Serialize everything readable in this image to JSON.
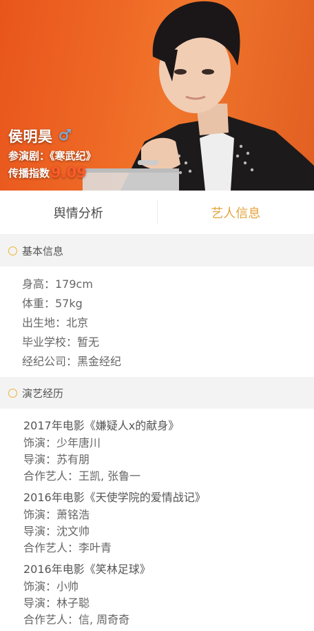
{
  "artist": {
    "name": "侯明昊",
    "gender_icon": "male-icon",
    "drama_line": "参演剧：《寒武纪》",
    "index_label": "传播指数",
    "index_value": "9.09"
  },
  "tabs": [
    {
      "label": "舆情分析",
      "active": false
    },
    {
      "label": "艺人信息",
      "active": true
    }
  ],
  "sections": {
    "basic": {
      "title": "基本信息",
      "items": [
        "身高：179cm",
        "体重：57kg",
        "出生地：北京",
        "毕业学校：暂无",
        "经纪公司：黑金经纪"
      ]
    },
    "career": {
      "title": "演艺经历",
      "entries": [
        {
          "title": "2017年电影《嫌疑人x的献身》",
          "role": "饰演：少年唐川",
          "director": "导演：苏有朋",
          "costars": "合作艺人：王凯, 张鲁一"
        },
        {
          "title": "2016年电影《天使学院的爱情战记》",
          "role": "饰演：萧铭浩",
          "director": "导演：沈文帅",
          "costars": "合作艺人：李叶青"
        },
        {
          "title": "2016年电影《笑林足球》",
          "role": "饰演：小帅",
          "director": "导演：林子聪",
          "costars": "合作艺人：信, 周奇奇"
        }
      ]
    }
  },
  "colors": {
    "accent": "#e3a43a",
    "hero_bg": "#ef6a26",
    "index_value": "#ff5a2a"
  }
}
